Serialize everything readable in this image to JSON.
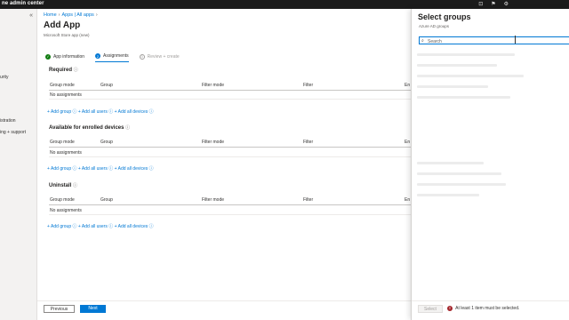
{
  "topbar": {
    "title": "ne admin center"
  },
  "leftnav": {
    "items": [
      "urity",
      "istration",
      "ing + support"
    ]
  },
  "breadcrumb": [
    "Home",
    "Apps | All apps"
  ],
  "page": {
    "title": "Add App",
    "subtitle": "Microsoft Store app (new)"
  },
  "steps": [
    {
      "label": "App information",
      "state": "done",
      "symbol": "✓"
    },
    {
      "label": "Assignments",
      "state": "active",
      "symbol": "2"
    },
    {
      "label": "Review + create",
      "state": "todo",
      "symbol": "3"
    }
  ],
  "columns": [
    "Group mode",
    "Group",
    "Filter mode",
    "Filter",
    "En"
  ],
  "sections": [
    {
      "title": "Required",
      "empty": "No assignments"
    },
    {
      "title": "Available for enrolled devices",
      "empty": "No assignments"
    },
    {
      "title": "Uninstall",
      "empty": "No assignments"
    }
  ],
  "add_links": "+ Add group ⓘ  + Add all users ⓘ  + Add all devices ⓘ",
  "info_glyph": "ⓘ",
  "footer": {
    "previous": "Previous",
    "next": "Next"
  },
  "panel": {
    "title": "Select groups",
    "subtitle": "Azure AD groups",
    "search_placeholder": "Search",
    "select_label": "Select",
    "error_icon": "!",
    "error": "At least 1 item must be selected."
  },
  "colors": {
    "accent": "#0078d4",
    "done": "#107c10",
    "error": "#a4262c"
  }
}
